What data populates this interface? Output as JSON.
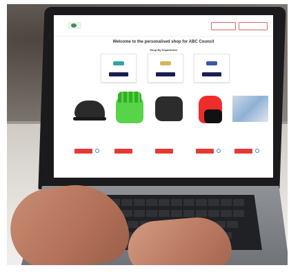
{
  "image": {
    "screen_page": {
      "header": {
        "button_1": "",
        "button_2": ""
      },
      "welcome_title": "Welcome to the personalised shop for ABC Council",
      "shop_by_department": "Shop By Department",
      "departments": [
        {
          "logo_color": "#35a3a4",
          "button_color": "#1c1d4f"
        },
        {
          "logo_color": "#d4b65a",
          "button_color": "#1c1d4f"
        },
        {
          "logo_color": "#3a56a5",
          "button_color": "#1c1d4f"
        }
      ],
      "products": [
        {
          "kind": "safety-shoe",
          "name": "",
          "price": ""
        },
        {
          "kind": "green-gloves",
          "name": "",
          "price": ""
        },
        {
          "kind": "safety-boot",
          "name": "",
          "price": ""
        },
        {
          "kind": "red-gloves",
          "name": "",
          "price": ""
        },
        {
          "kind": "blue-gloves",
          "name": "",
          "price": ""
        }
      ],
      "accent_colors": {
        "add_button": "#e53935",
        "header_button_border": "#e16060",
        "department_button": "#1c1d4f"
      }
    }
  }
}
